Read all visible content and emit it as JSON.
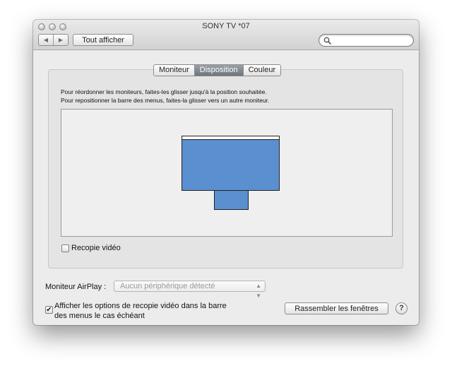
{
  "window": {
    "title": "SONY TV  *07"
  },
  "toolbar": {
    "back_glyph": "◀",
    "forward_glyph": "▶",
    "show_all_label": "Tout afficher",
    "search_value": ""
  },
  "tabs": [
    {
      "label": "Moniteur",
      "active": false
    },
    {
      "label": "Disposition",
      "active": true
    },
    {
      "label": "Couleur",
      "active": false
    }
  ],
  "instructions": {
    "line1": "Pour réordonner les moniteurs, faites-les glisser jusqu'à la position souhaitée.",
    "line2": "Pour repositionner la barre des menus, faites-la glisser vers un autre moniteur."
  },
  "arrangement": {
    "display_color": "#5a8fd0",
    "menubar_color": "#ffffff"
  },
  "mirroring": {
    "label": "Recopie vidéo",
    "checked": false
  },
  "airplay": {
    "label": "Moniteur AirPlay :",
    "selected": "Aucun périphérique détecté"
  },
  "menu_options": {
    "line1": "Afficher les options de recopie vidéo dans la barre",
    "line2": "des menus le cas échéant",
    "checked": true,
    "check_glyph": "✔"
  },
  "gather_windows_label": "Rassembler les fenêtres",
  "help_glyph": "?"
}
